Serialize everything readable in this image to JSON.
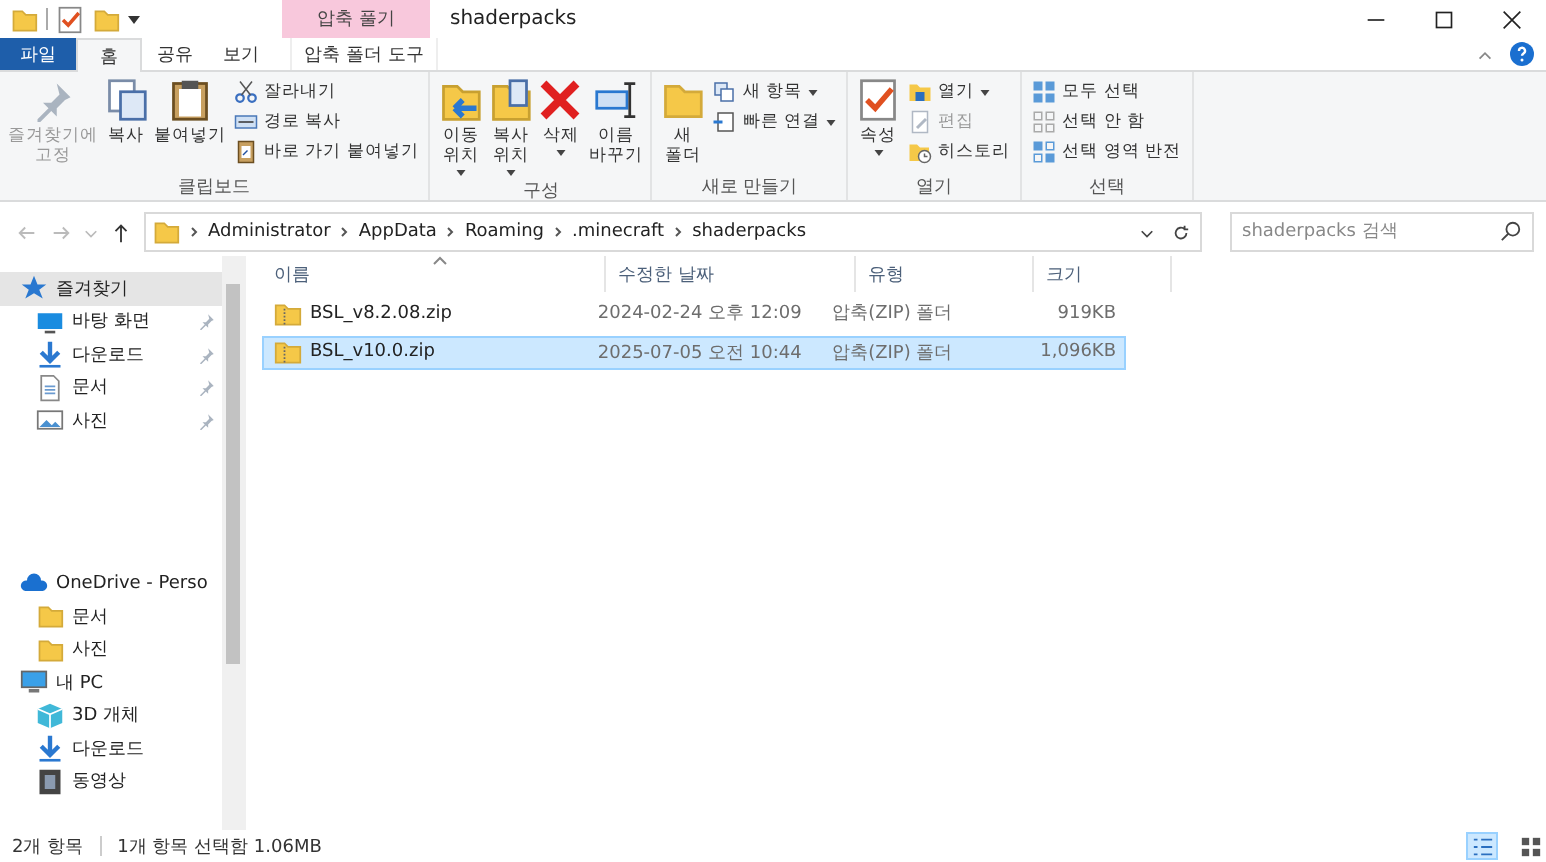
{
  "window": {
    "title": "shaderpacks",
    "context_group": "압축 풀기"
  },
  "tabs": [
    {
      "label": "파일",
      "kind": "file",
      "selected": false
    },
    {
      "label": "홈",
      "kind": "normal",
      "selected": true
    },
    {
      "label": "공유",
      "kind": "normal",
      "selected": false
    },
    {
      "label": "보기",
      "kind": "normal",
      "selected": false
    },
    {
      "label": "압축 폴더 도구",
      "kind": "context",
      "selected": false
    }
  ],
  "ribbon": [
    {
      "label": "클립보드",
      "columns": [
        [
          {
            "label": "즐겨찾기에 고정",
            "kind": "pin",
            "disabled": true,
            "dropdown": false
          }
        ],
        [
          {
            "label": "복사",
            "kind": "copy",
            "disabled": false,
            "dropdown": false
          }
        ],
        [
          {
            "label": "붙여넣기",
            "kind": "paste",
            "disabled": false,
            "dropdown": false
          }
        ],
        [
          {
            "label": "잘라내기",
            "kind": "cut",
            "disabled": false,
            "dropdown": false
          },
          {
            "label": "경로 복사",
            "kind": "path",
            "disabled": false,
            "dropdown": false
          },
          {
            "label": "바로 가기 붙여넣기",
            "kind": "shortcut",
            "disabled": false,
            "dropdown": false
          }
        ]
      ]
    },
    {
      "label": "구성",
      "columns": [
        [
          {
            "label": "이동 위치",
            "kind": "move",
            "disabled": false,
            "dropdown": true
          }
        ],
        [
          {
            "label": "복사 위치",
            "kind": "copyto",
            "disabled": false,
            "dropdown": true
          }
        ],
        [
          {
            "label": "삭제",
            "kind": "delete",
            "disabled": false,
            "dropdown": true
          }
        ],
        [
          {
            "label": "이름 바꾸기",
            "kind": "rename",
            "disabled": false,
            "dropdown": false
          }
        ]
      ]
    },
    {
      "label": "새로 만들기",
      "columns": [
        [
          {
            "label": "새 폴더",
            "kind": "folder",
            "disabled": false,
            "dropdown": false
          }
        ],
        [
          {
            "label": "새 항목",
            "kind": "newitem",
            "disabled": false,
            "dropdown": true
          },
          {
            "label": "빠른 연결",
            "kind": "easy",
            "disabled": false,
            "dropdown": true
          }
        ]
      ]
    },
    {
      "label": "열기",
      "columns": [
        [
          {
            "label": "속성",
            "kind": "props",
            "disabled": false,
            "dropdown": true
          }
        ],
        [
          {
            "label": "열기",
            "kind": "open",
            "disabled": false,
            "dropdown": true
          },
          {
            "label": "편집",
            "kind": "edit",
            "disabled": true,
            "dropdown": false
          },
          {
            "label": "히스토리",
            "kind": "history",
            "disabled": false,
            "dropdown": false
          }
        ]
      ]
    },
    {
      "label": "선택",
      "columns": [
        [
          {
            "label": "모두 선택",
            "kind": "selall",
            "disabled": false,
            "dropdown": false
          },
          {
            "label": "선택 안 함",
            "kind": "selnone",
            "disabled": false,
            "dropdown": false
          },
          {
            "label": "선택 영역 반전",
            "kind": "selinv",
            "disabled": false,
            "dropdown": false
          }
        ]
      ]
    }
  ],
  "address": {
    "path": [
      "Administrator",
      "AppData",
      "Roaming",
      ".minecraft",
      "shaderpacks"
    ]
  },
  "search": {
    "placeholder": "shaderpacks 검색"
  },
  "navigation": [
    {
      "label": "즐겨찾기",
      "kind": "star",
      "selected": true,
      "children": [
        {
          "label": "바탕 화면",
          "kind": "desktop",
          "pinned": true
        },
        {
          "label": "다운로드",
          "kind": "download",
          "pinned": true
        },
        {
          "label": "문서",
          "kind": "document",
          "pinned": true
        },
        {
          "label": "사진",
          "kind": "pictures",
          "pinned": true
        }
      ]
    },
    {
      "label": "OneDrive - Perso",
      "kind": "cloud",
      "selected": false,
      "children": [
        {
          "label": "문서",
          "kind": "folder",
          "pinned": false
        },
        {
          "label": "사진",
          "kind": "folder",
          "pinned": false
        }
      ]
    },
    {
      "label": "내 PC",
      "kind": "pc",
      "selected": false,
      "children": [
        {
          "label": "3D 개체",
          "kind": "objects",
          "pinned": false
        },
        {
          "label": "다운로드",
          "kind": "download",
          "pinned": false
        },
        {
          "label": "동영상",
          "kind": "video",
          "pinned": false
        }
      ]
    }
  ],
  "table": {
    "columns": [
      {
        "label": "이름",
        "sorted": true
      },
      {
        "label": "수정한 날짜",
        "sorted": false
      },
      {
        "label": "유형",
        "sorted": false
      },
      {
        "label": "크기",
        "sorted": false
      }
    ],
    "rows": [
      {
        "name": "BSL_v8.2.08.zip",
        "modified": "2024-02-24 오후 12:09",
        "type": "압축(ZIP) 폴더",
        "size": "919KB",
        "selected": false
      },
      {
        "name": "BSL_v10.0.zip",
        "modified": "2025-07-05 오전 10:44",
        "type": "압축(ZIP) 폴더",
        "size": "1,096KB",
        "selected": true
      }
    ]
  },
  "status_bar": {
    "items": "2개 항목",
    "selection": "1개 항목 선택함 1.06MB",
    "views": [
      {
        "kind": "details",
        "selected": true
      },
      {
        "kind": "tiles",
        "selected": false
      }
    ]
  }
}
